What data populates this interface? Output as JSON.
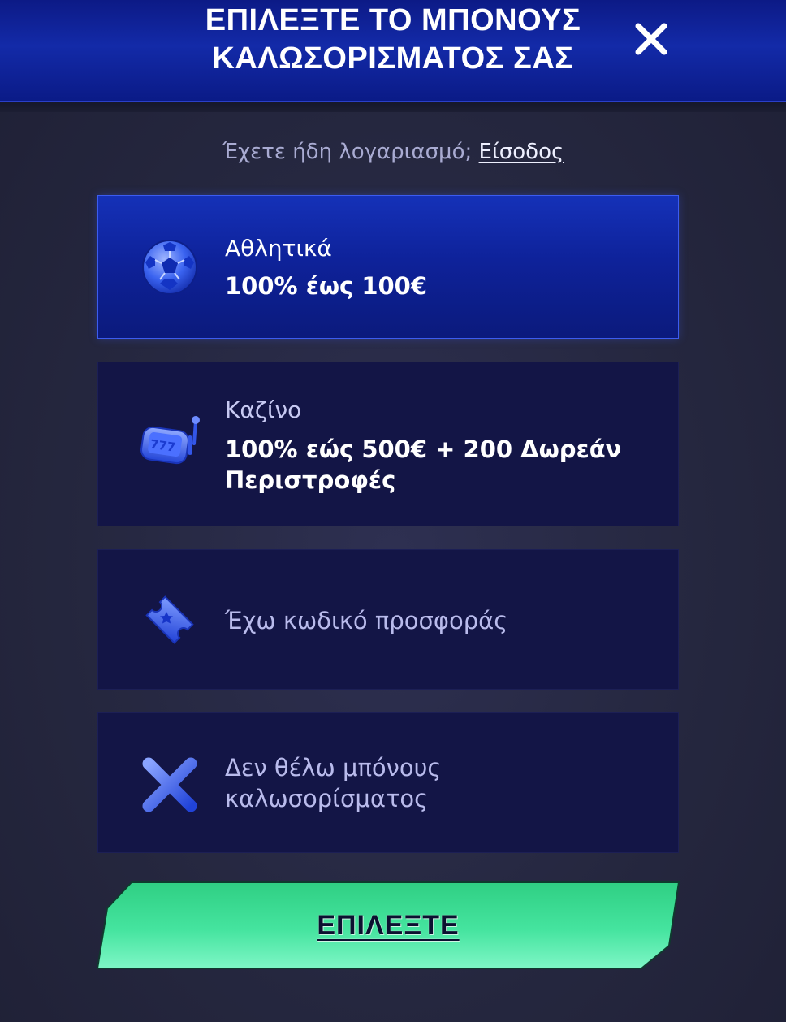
{
  "header": {
    "title_line1": "ΕΠΙΛΕΞΤΕ ΤΟ ΜΠΟΝΟΥΣ",
    "title_line2": "ΚΑΛΩΣΟΡΙΣΜΑΤΟΣ ΣΑΣ",
    "close_icon": "close-icon"
  },
  "login": {
    "prompt": "Έχετε ήδη λογαριασμό; ",
    "link_label": "Είσοδος"
  },
  "options": [
    {
      "icon": "soccer-ball-icon",
      "title": "Αθλητικά",
      "value": "100% έως 100€",
      "selected": true
    },
    {
      "icon": "slot-machine-icon",
      "title": "Καζίνο",
      "value": "100% εώς 500€ + 200 Δωρεάν Περιστροφές",
      "selected": false
    },
    {
      "icon": "ticket-icon",
      "text": "Έχω κωδικό προσφοράς",
      "selected": false
    },
    {
      "icon": "x-icon",
      "text": "Δεν θέλω μπόνους καλωσορίσματος",
      "selected": false
    }
  ],
  "cta": {
    "label": "ΕΠΙΛΕΞΤΕ"
  },
  "colors": {
    "accent_blue": "#1531b8",
    "panel": "#131546",
    "cta_green": "#3ee79b"
  }
}
